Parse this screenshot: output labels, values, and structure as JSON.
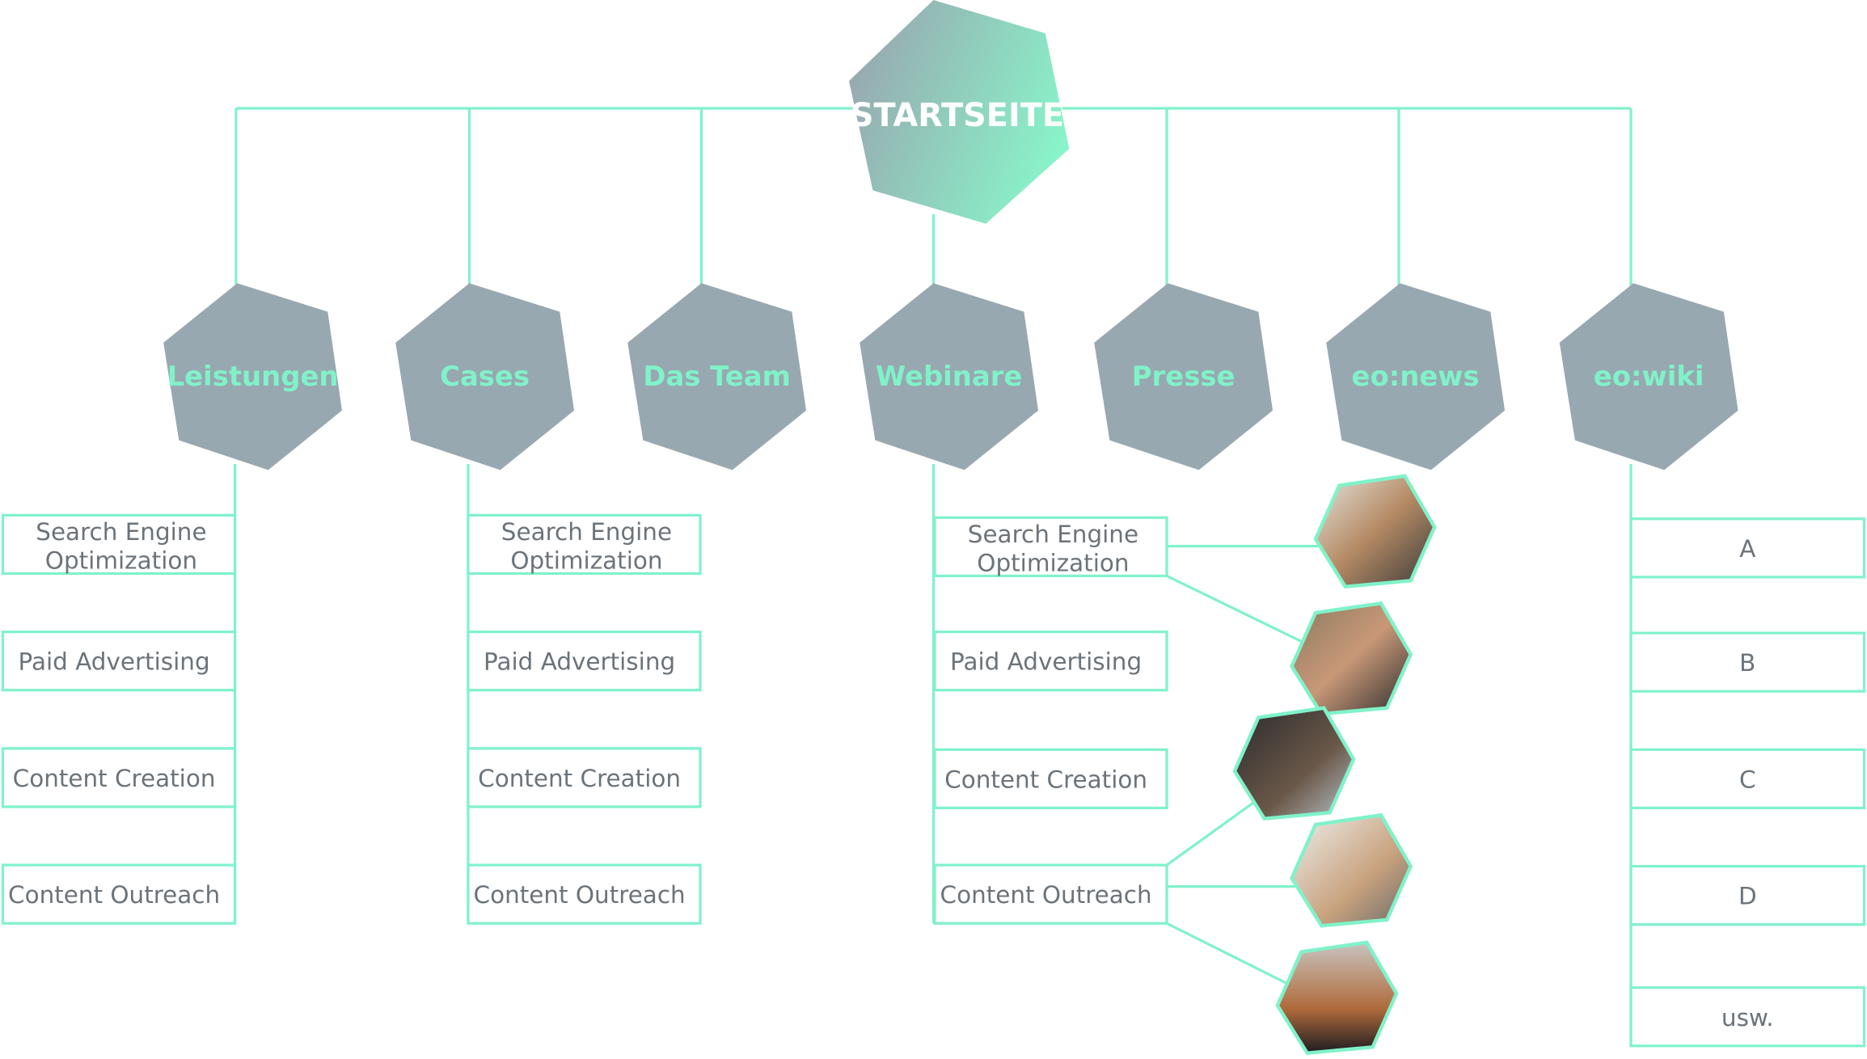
{
  "root": {
    "label": "STARTSEITE"
  },
  "colors": {
    "accent": "#80f2c9",
    "hex_gray": "#98a8b0",
    "text_gray": "#6b737a"
  },
  "sections": [
    {
      "label": "Leistungen",
      "items": [
        [
          "Search Engine",
          "Optimization"
        ],
        [
          "Paid Advertising"
        ],
        [
          "Content Creation"
        ],
        [
          "Content Outreach"
        ]
      ]
    },
    {
      "label": "Cases",
      "items": [
        [
          "Search Engine",
          "Optimization"
        ],
        [
          "Paid Advertising"
        ],
        [
          "Content Creation"
        ],
        [
          "Content Outreach"
        ]
      ]
    },
    {
      "label": "Das Team",
      "items": []
    },
    {
      "label": "Webinare",
      "items": [
        [
          "Search Engine",
          "Optimization"
        ],
        [
          "Paid Advertising"
        ],
        [
          "Content Creation"
        ],
        [
          "Content Outreach"
        ]
      ]
    },
    {
      "label": "Presse",
      "items": []
    },
    {
      "label": "eo:news",
      "items": []
    },
    {
      "label": "eo:wiki",
      "items": [
        [
          "A"
        ],
        [
          "B"
        ],
        [
          "C"
        ],
        [
          "D"
        ],
        [
          "usw."
        ]
      ]
    }
  ],
  "photos": [
    "woman-with-headset-photo",
    "man-with-headset-photo",
    "man-with-laptop-photo",
    "woman-at-desk-photo",
    "person-at-window-photo"
  ]
}
